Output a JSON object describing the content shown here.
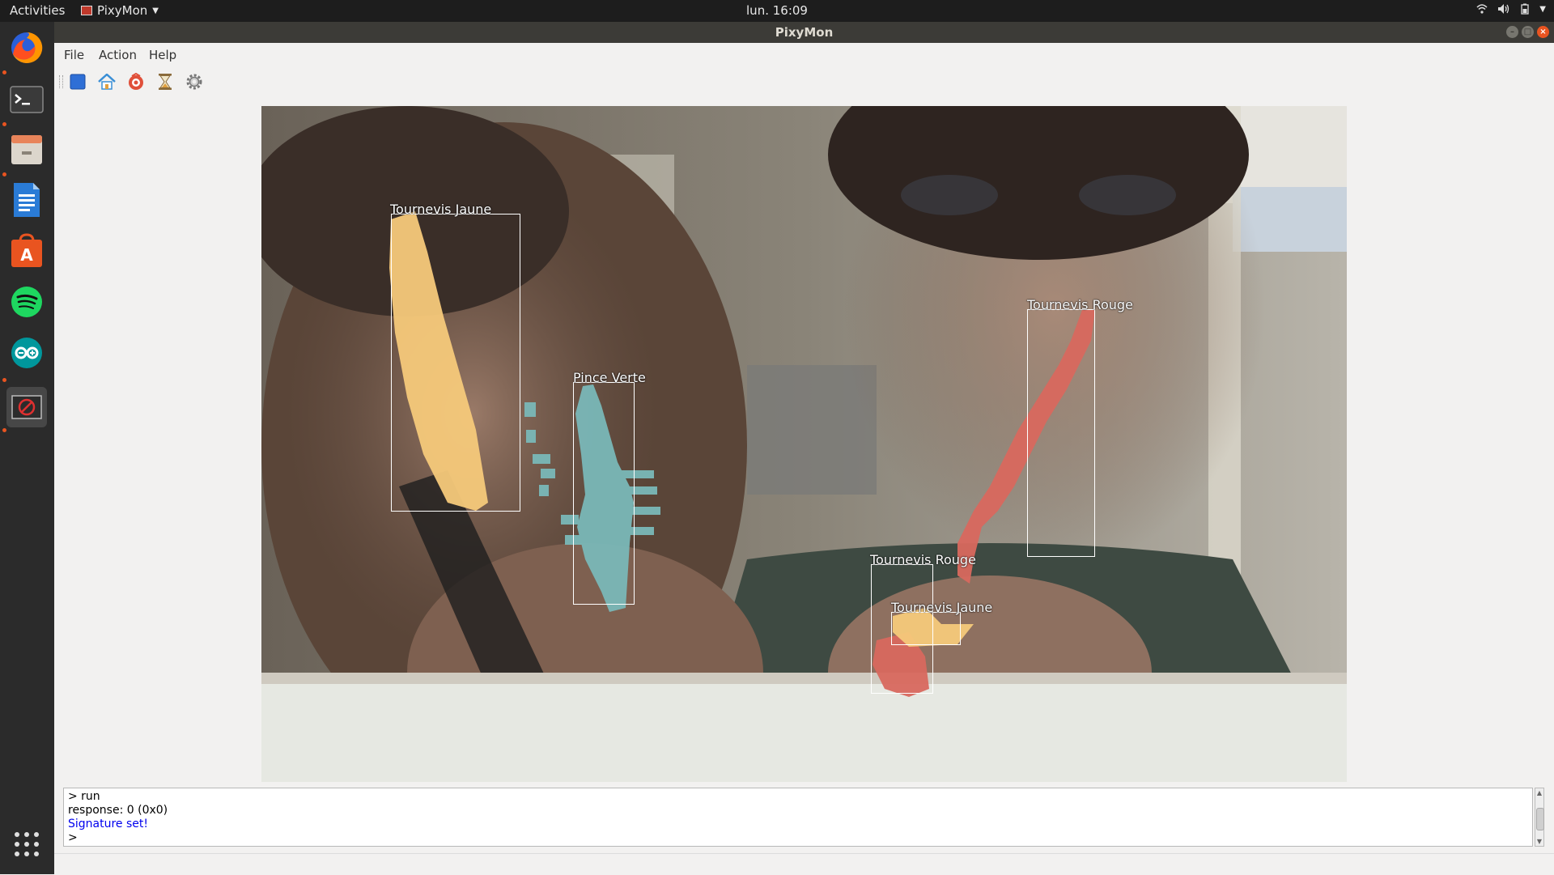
{
  "topbar": {
    "activities": "Activities",
    "app_name": "PixyMon",
    "clock": "lun. 16:09"
  },
  "window": {
    "title": "PixyMon"
  },
  "menu": {
    "file": "File",
    "action": "Action",
    "help": "Help"
  },
  "toolbar": {
    "icons": [
      "stop-icon",
      "home-icon",
      "raw-video-icon",
      "hourglass-icon",
      "settings-icon"
    ]
  },
  "dock": {
    "apps": [
      "firefox-icon",
      "terminal-icon",
      "files-icon",
      "writer-icon",
      "software-center-icon",
      "spotify-icon",
      "arduino-icon",
      "pixymon-icon",
      "show-apps-icon"
    ]
  },
  "detections": [
    {
      "label": "Tournevis Jaune",
      "color": "#f5c97a"
    },
    {
      "label": "Pince Verte",
      "color": "#7ab8b8"
    },
    {
      "label": "Tournevis Rouge",
      "color": "#d8685e"
    },
    {
      "label": "Tournevis Rouge",
      "color": "#d8685e"
    },
    {
      "label": "Tournevis Jaune",
      "color": "#f5c97a"
    }
  ],
  "console": {
    "lines": [
      "> run",
      "response: 0 (0x0)",
      "Signature set!",
      ">"
    ]
  },
  "colors": {
    "accent": "#e95420",
    "signature_text": "#0000ee"
  }
}
